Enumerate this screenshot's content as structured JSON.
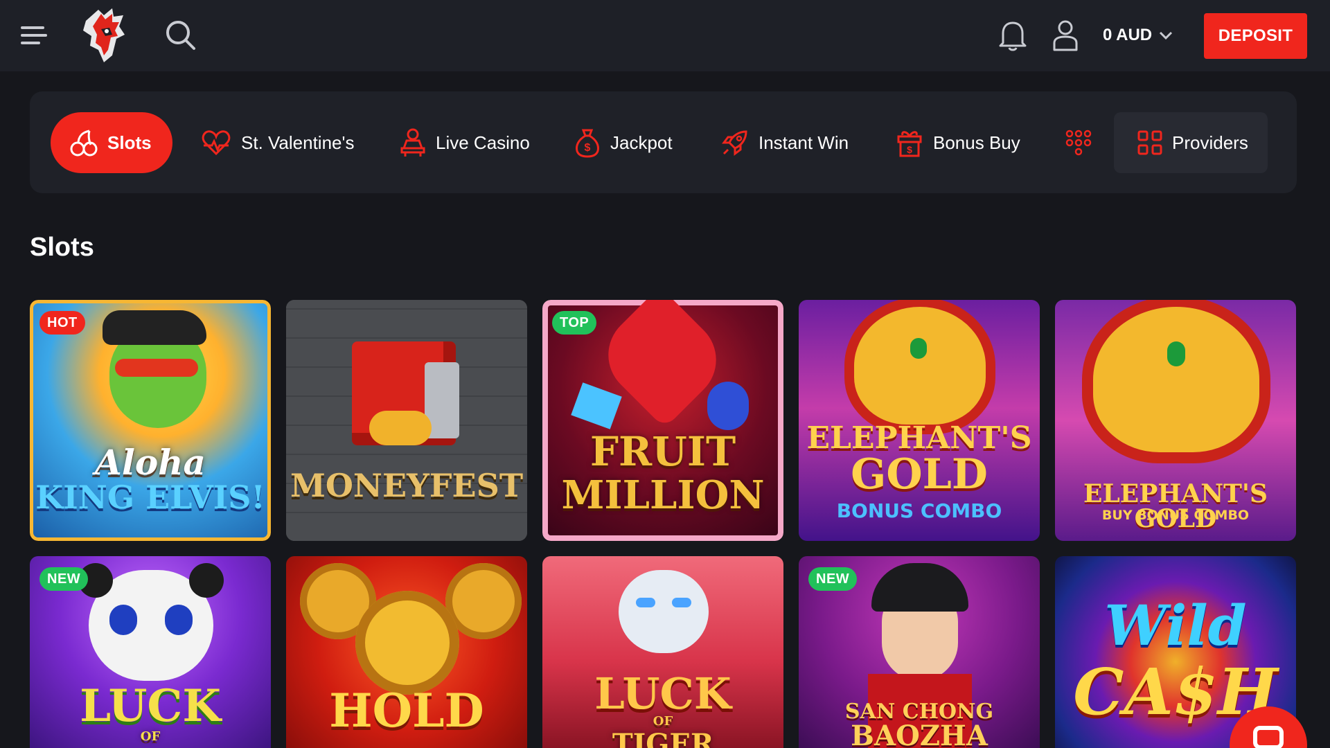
{
  "header": {
    "menu_icon": "hamburger-menu-icon",
    "logo_icon": "rooster-logo-icon",
    "search_icon": "search-icon",
    "notifications_icon": "bell-icon",
    "profile_icon": "user-icon",
    "balance": "0 AUD",
    "balance_icon": "chevron-down-icon",
    "deposit_label": "DEPOSIT"
  },
  "categories": [
    {
      "label": "Slots",
      "icon": "cherries-icon",
      "active": true
    },
    {
      "label": "St. Valentine's",
      "icon": "heart-icon"
    },
    {
      "label": "Live Casino",
      "icon": "dealer-icon"
    },
    {
      "label": "Jackpot",
      "icon": "money-bag-icon"
    },
    {
      "label": "Instant Win",
      "icon": "rocket-icon"
    },
    {
      "label": "Bonus Buy",
      "icon": "gift-icon"
    },
    {
      "label": "",
      "icon": "more-dots-icon"
    },
    {
      "label": "Providers",
      "icon": "grid-icon"
    }
  ],
  "section": {
    "title": "Slots"
  },
  "games": [
    {
      "title_line1": "Aloha",
      "title_line2": "KING ELVIS!",
      "badge": "HOT"
    },
    {
      "title_line1": "MONEYFEST",
      "title_line2": "",
      "badge": ""
    },
    {
      "title_line1": "FRUIT",
      "title_line2": "MILLION",
      "badge": "TOP"
    },
    {
      "title_line1": "ELEPHANT'S",
      "title_line2": "GOLD",
      "subtitle": "BONUS COMBO",
      "badge": ""
    },
    {
      "title_line1": "ELEPHANT'S GOLD",
      "title_line2": "",
      "subtitle": "BUY BONUS COMBO",
      "badge": ""
    },
    {
      "title_line1": "LUCK",
      "title_line2": "OF",
      "badge": "NEW"
    },
    {
      "title_line1": "HOLD",
      "title_line2": "",
      "badge": ""
    },
    {
      "title_line1": "LUCK",
      "title_line2": "OF",
      "subtitle": "TIGER",
      "badge": ""
    },
    {
      "title_line1": "SAN CHONG",
      "title_line2": "BAOZHA",
      "badge": "NEW"
    },
    {
      "title_line1": "Wild",
      "title_line2": "CA$H",
      "badge": ""
    }
  ],
  "colors": {
    "brand_red": "#f0261d",
    "header_bg": "#1e2027",
    "page_bg": "#16171c",
    "badge_green": "#21c15a"
  }
}
